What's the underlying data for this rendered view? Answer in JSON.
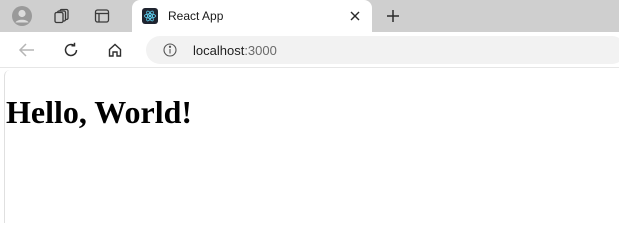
{
  "browser": {
    "tab": {
      "title": "React App",
      "favicon": "react-logo-icon"
    },
    "address_bar": {
      "host": "localhost",
      "port": ":3000"
    },
    "icons": [
      "profile-icon",
      "workspaces-icon",
      "tab-actions-icon",
      "close-icon",
      "new-tab-icon",
      "back-arrow-icon",
      "reload-icon",
      "home-icon",
      "site-info-icon"
    ]
  },
  "page": {
    "heading": "Hello, World!"
  },
  "colors": {
    "tabstrip": "#cfcfcf",
    "react_logo": "#61dafb",
    "favicon_bg": "#1f2430"
  }
}
